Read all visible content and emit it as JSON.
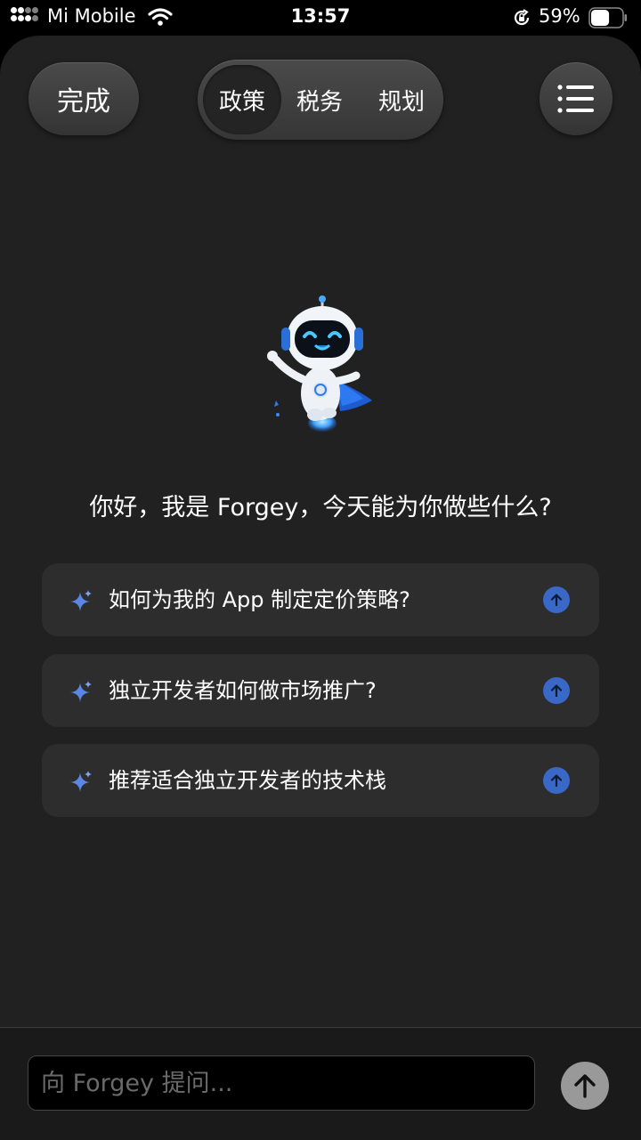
{
  "status_bar": {
    "carrier": "Mi Mobile",
    "time": "13:57",
    "battery_percent": "59%",
    "battery_level": 0.59
  },
  "header": {
    "done_label": "完成",
    "tabs": [
      {
        "label": "政策",
        "selected": true
      },
      {
        "label": "税务",
        "selected": false
      },
      {
        "label": "规划",
        "selected": false
      }
    ],
    "menu_icon": "list-icon"
  },
  "main": {
    "mascot_icon": "robot-mascot",
    "greeting": "你好，我是 Forgey，今天能为你做些什么?",
    "suggestions": [
      {
        "text": "如何为我的 App 制定定价策略?"
      },
      {
        "text": "独立开发者如何做市场推广?"
      },
      {
        "text": "推荐适合独立开发者的技术栈"
      }
    ]
  },
  "composer": {
    "placeholder": "向 Forgey 提问...",
    "value": ""
  },
  "colors": {
    "background": "#212121",
    "card": "#2d2d2d",
    "accent": "#3a68c6",
    "send_button": "#999999"
  }
}
